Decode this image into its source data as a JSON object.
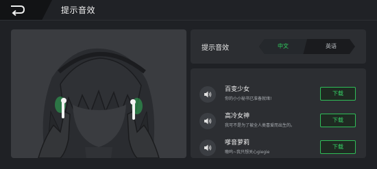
{
  "header": {
    "title": "提示音效"
  },
  "language": {
    "label": "提示音效",
    "options": [
      "中文",
      "英语"
    ],
    "selected": "中文",
    "accent_color": "#2fcf5f"
  },
  "sounds": [
    {
      "title": "百变少女",
      "desc": "你的小小秘书已准备就绪!",
      "button": "下载"
    },
    {
      "title": "高冷女神",
      "desc": "我可不是为了被全人类喜爱而出生的。",
      "button": "下载"
    },
    {
      "title": "嗲音萝莉",
      "desc": "嗷呜~我只想关心giegie",
      "button": "下载"
    }
  ],
  "icons": {
    "back": "back-arrow-icon",
    "speaker": "speaker-icon"
  }
}
